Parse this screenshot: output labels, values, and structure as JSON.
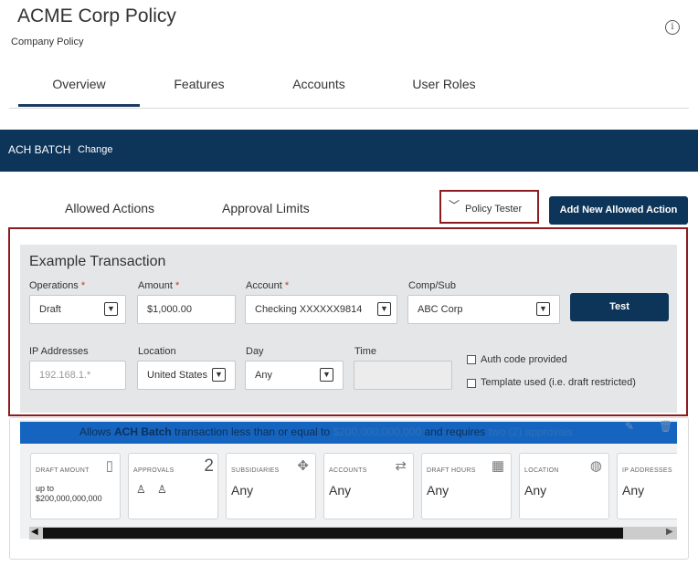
{
  "header": {
    "title": "ACME Corp Policy",
    "subtitle": "Company Policy",
    "info_icon": "i"
  },
  "tabs": [
    {
      "label": "Overview",
      "active": true
    },
    {
      "label": "Features"
    },
    {
      "label": "Accounts"
    },
    {
      "label": "User Roles"
    }
  ],
  "banner": {
    "title": "ACH BATCH",
    "change_label": "Change"
  },
  "subtabs": [
    {
      "label": "Allowed Actions",
      "active": true
    },
    {
      "label": "Approval Limits"
    }
  ],
  "policy_tester": {
    "chevron": "﹀",
    "label": "Policy Tester"
  },
  "add_button": "Add New Allowed Action",
  "example": {
    "title": "Example Transaction",
    "operations": {
      "label": "Operations",
      "required": "*",
      "value": "Draft"
    },
    "amount": {
      "label": "Amount",
      "required": "*",
      "value": "$1,000.00"
    },
    "account": {
      "label": "Account",
      "required": "*",
      "value": "Checking XXXXXX9814"
    },
    "comp_sub": {
      "label": "Comp/Sub",
      "value": "ABC Corp"
    },
    "test_button": "Test",
    "ip": {
      "label": "IP Addresses",
      "placeholder": "192.168.1.*"
    },
    "location": {
      "label": "Location",
      "value": "United States"
    },
    "day": {
      "label": "Day",
      "value": "Any"
    },
    "time": {
      "label": "Time",
      "value": ""
    },
    "auth_code": {
      "label": "Auth code provided",
      "checked": false
    },
    "template_used": {
      "label": "Template used (i.e. draft restricted)",
      "checked": false
    },
    "select_arrow": "▼"
  },
  "rule": {
    "text_1": "Allows ",
    "text_2": "ACH Batch",
    "text_3": " transaction less than or equal to ",
    "text_4": "$200,000,000,000",
    "text_5": " and requires ",
    "text_6": "two (2) approvals",
    "edit_icon": "✎",
    "delete_icon": "🗑",
    "tiles": [
      {
        "label": "DRAFT AMOUNT",
        "value_1": "up to",
        "value_2": "$200,000,000,000",
        "icon": "▯"
      },
      {
        "label": "APPROVALS",
        "count": "2",
        "person_1": "♙",
        "person_2": "♙"
      },
      {
        "label": "SUBSIDIARIES",
        "value": "Any",
        "icon": "✥"
      },
      {
        "label": "ACCOUNTS",
        "value": "Any",
        "icon": "⇄"
      },
      {
        "label": "DRAFT HOURS",
        "value": "Any",
        "icon": "▦"
      },
      {
        "label": "LOCATION",
        "value": "Any",
        "icon": "◍"
      },
      {
        "label": "IP ADDRESSES",
        "value": "Any"
      }
    ]
  },
  "scrollbar": {
    "left_arrow": "◀",
    "right_arrow": "▶"
  }
}
